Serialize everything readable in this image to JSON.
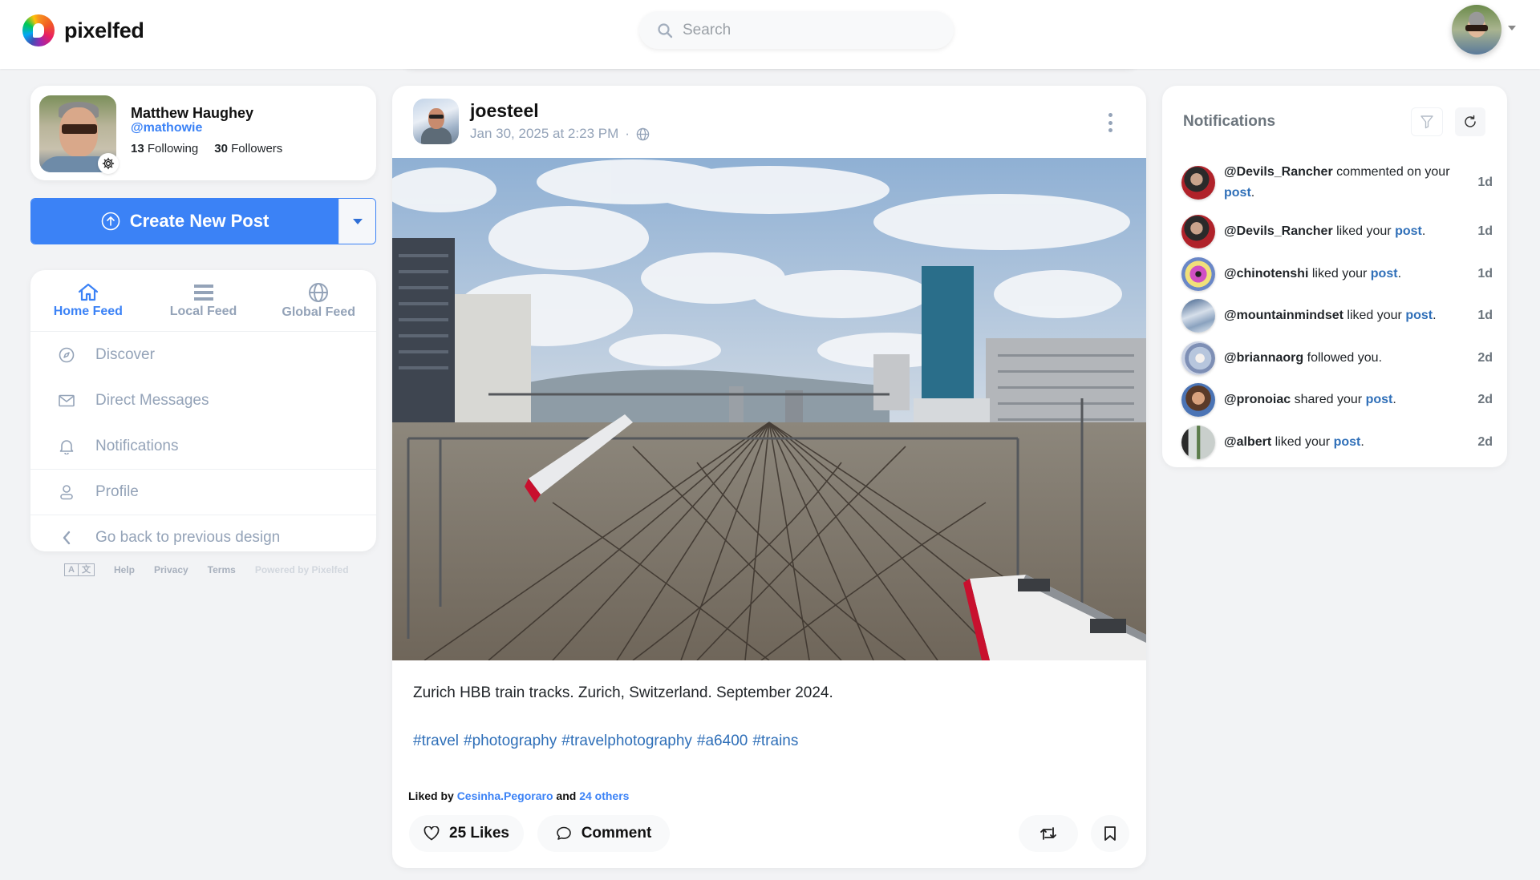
{
  "navbar": {
    "brand_name": "pixelfed",
    "search_placeholder": "Search"
  },
  "profile": {
    "name": "Matthew Haughey",
    "handle": "@mathowie",
    "following_count": "13",
    "following_label": "Following",
    "followers_count": "30",
    "followers_label": "Followers"
  },
  "create_post": {
    "label": "Create New Post"
  },
  "feed_tabs": [
    {
      "label": "Home Feed",
      "icon": "home-icon",
      "active": true
    },
    {
      "label": "Local Feed",
      "icon": "list-icon",
      "active": false
    },
    {
      "label": "Global Feed",
      "icon": "globe-icon",
      "active": false
    }
  ],
  "nav_items": [
    {
      "label": "Discover",
      "icon": "compass-icon"
    },
    {
      "label": "Direct Messages",
      "icon": "envelope-icon"
    },
    {
      "label": "Notifications",
      "icon": "bell-icon"
    },
    {
      "label": "Profile",
      "icon": "user-icon"
    },
    {
      "label": "Go back to previous design",
      "icon": "chevron-left-icon"
    }
  ],
  "footer": {
    "lang_a": "A",
    "lang_b": "文",
    "help": "Help",
    "privacy": "Privacy",
    "terms": "Terms",
    "powered": "Powered by Pixelfed"
  },
  "post": {
    "username": "joesteel",
    "timestamp": "Jan 30, 2025 at 2:23 PM",
    "separator": "·",
    "visibility_icon": "globe-icon",
    "caption": "Zurich HBB train tracks. Zurich, Switzerland. September 2024.",
    "hashtags": [
      "#travel",
      "#photography",
      "#travelphotography",
      "#a6400",
      "#trains"
    ],
    "liked_by_prefix": "Liked by",
    "liked_by_user": "Cesinha.Pegoraro",
    "liked_by_and": "and",
    "liked_by_others": "24 others",
    "likes_label": "25 Likes",
    "comment_label": "Comment"
  },
  "notifications": {
    "title": "Notifications",
    "items": [
      {
        "user": "@Devils_Rancher",
        "action": "commented on your",
        "link": "post",
        "time": "1d",
        "avatar_color": "#8b2b2b"
      },
      {
        "user": "@Devils_Rancher",
        "action": "liked your",
        "link": "post",
        "time": "1d",
        "avatar_color": "#8b2b2b"
      },
      {
        "user": "@chinotenshi",
        "action": "liked your",
        "link": "post",
        "time": "1d",
        "avatar_color": "#c24bb8"
      },
      {
        "user": "@mountainmindset",
        "action": "liked your",
        "link": "post",
        "time": "1d",
        "avatar_color": "#7d96b6"
      },
      {
        "user": "@briannaorg",
        "action": "followed you.",
        "link": "",
        "time": "2d",
        "avatar_color": "#a9b3cc"
      },
      {
        "user": "@pronoiac",
        "action": "shared your",
        "link": "post",
        "time": "2d",
        "avatar_color": "#6b4a3a"
      },
      {
        "user": "@albert",
        "action": "liked your",
        "link": "post",
        "time": "2d",
        "avatar_color": "#7c8c8a"
      }
    ]
  },
  "colors": {
    "accent": "#3b82f6",
    "link": "#2f6fb8",
    "muted": "#94a3b8",
    "background": "#f2f3f5"
  }
}
